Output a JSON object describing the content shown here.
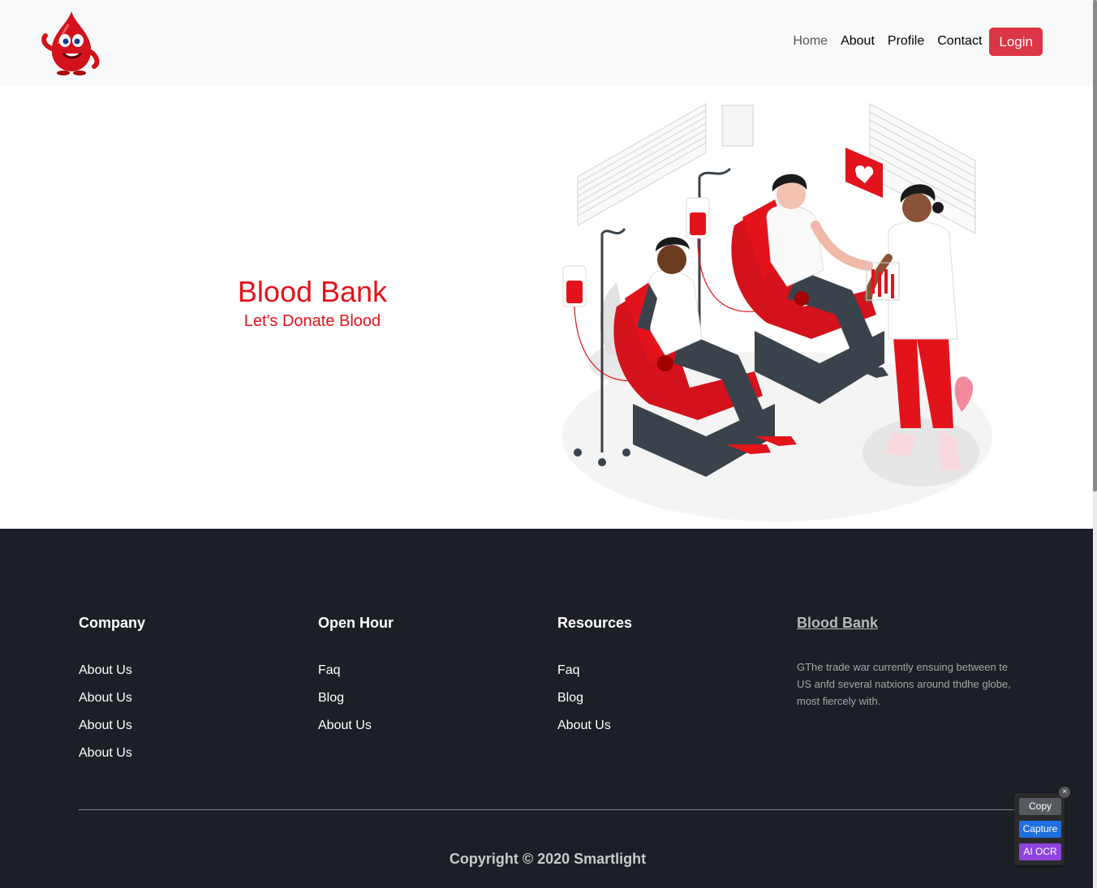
{
  "nav": {
    "logo_name": "blood-drop-mascot",
    "links": [
      "Home",
      "About",
      "Profile",
      "Contact"
    ],
    "login_label": "Login"
  },
  "hero": {
    "title": "Blood Bank",
    "subtitle": "Let's Donate Blood",
    "accent_color": "#e3131b"
  },
  "footer": {
    "columns": [
      {
        "title": "Company",
        "items": [
          "About Us",
          "About Us",
          "About Us",
          "About Us"
        ]
      },
      {
        "title": "Open Hour",
        "items": [
          "Faq",
          "Blog",
          "About Us"
        ]
      },
      {
        "title": "Resources",
        "items": [
          "Faq",
          "Blog",
          "About Us"
        ]
      }
    ],
    "brand": {
      "title": "Blood Bank",
      "text": "GThe trade war currently ensuing between te US anfd several natxions around thdhe globe, most fiercely with."
    },
    "copyright": "Copyright © 2020 Smartlight"
  },
  "widget": {
    "copy": "Copy",
    "capture": "Capture",
    "ai_ocr": "AI OCR",
    "close": "×"
  },
  "colors": {
    "primary_red": "#dc3545",
    "footer_bg": "#1c1f25",
    "navbar_bg": "#f8f9fa"
  }
}
